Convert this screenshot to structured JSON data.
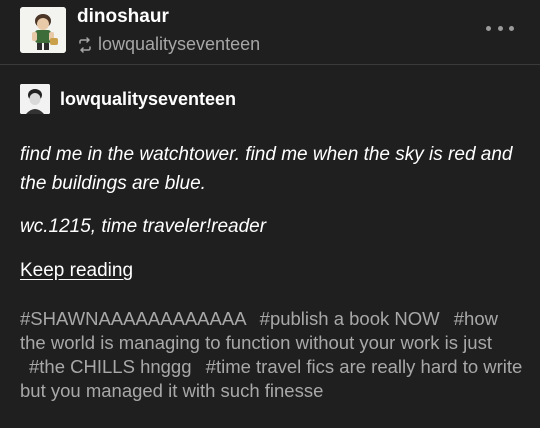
{
  "post": {
    "reblogger": "dinoshaur",
    "reblogged_from": "lowqualityseventeen",
    "source": {
      "username": "lowqualityseventeen"
    },
    "body": {
      "paragraph_1": "find me in the watchtower. find me when the sky is red and the buildings are blue.",
      "paragraph_2": "wc.1215, time traveler!reader"
    },
    "keep_reading_label": "Keep reading",
    "tags": [
      "#SHAWNAAAAAAAAAAAA",
      "#publish a book NOW",
      "#how the world is managing to function without your work is just",
      "#the CHILLS hnggg",
      "#time travel fics are really hard to write but you managed it with such finesse"
    ]
  },
  "icons": {
    "reblog": "reblog-icon",
    "more": "more-options-icon"
  },
  "colors": {
    "background": "#1f1f1f",
    "text": "#ffffff",
    "muted": "#a6a6a6"
  }
}
